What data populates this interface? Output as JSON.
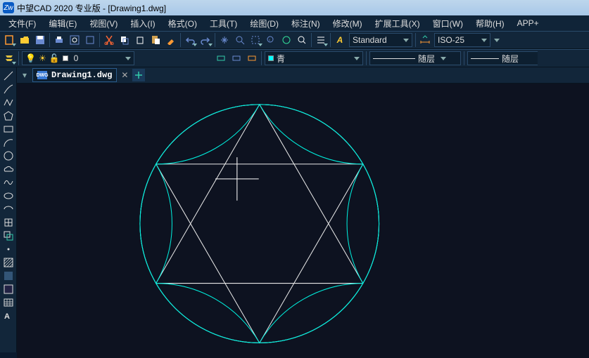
{
  "title": "中望CAD 2020 专业版 - [Drawing1.dwg]",
  "logo": "Zw",
  "menu": {
    "file": "文件(F)",
    "edit": "编辑(E)",
    "view": "视图(V)",
    "insert": "插入(I)",
    "format": "格式(O)",
    "tools": "工具(T)",
    "draw": "绘图(D)",
    "dim": "标注(N)",
    "modify": "修改(M)",
    "ext": "扩展工具(X)",
    "window": "窗口(W)",
    "help": "帮助(H)",
    "app": "APP+"
  },
  "toolbar1": {
    "textstyle": {
      "mode": "A",
      "value": "Standard"
    },
    "dimstyle": "ISO-25"
  },
  "toolbar2": {
    "layer": "0",
    "color_label": "青",
    "linetype": "随层",
    "lineweight": "随层"
  },
  "tab": {
    "name": "Drawing1.dwg",
    "icon": "DWG"
  },
  "icons": {
    "new": "□",
    "open": "📂",
    "save": "💾",
    "print": "🖶",
    "preview": "🗔",
    "cut": "✂",
    "copy1": "📋",
    "copy2": "🗐",
    "paste": "📄",
    "match": "🖌",
    "undo": "↶",
    "redo": "↷",
    "pan": "✋",
    "zoom": "🔍",
    "zoomp": "🔎",
    "zoome": "⛶",
    "lens": "🔍",
    "props": "≡"
  },
  "cross": "+"
}
